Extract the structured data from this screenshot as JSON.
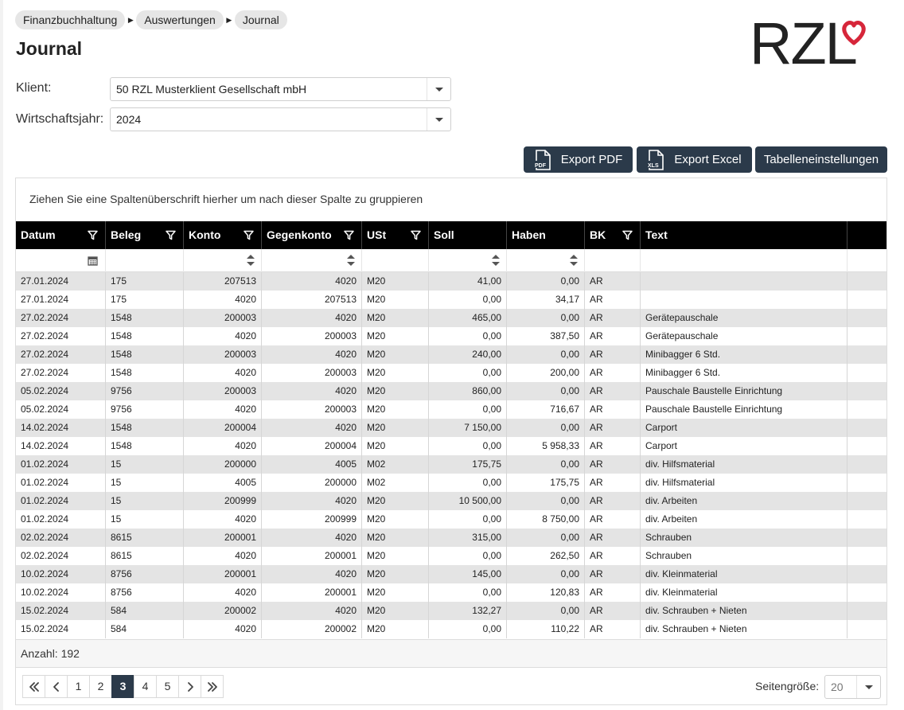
{
  "breadcrumb": [
    "Finanzbuchhaltung",
    "Auswertungen",
    "Journal"
  ],
  "page_title": "Journal",
  "form": {
    "klient_label": "Klient:",
    "klient_value": "50 RZL Musterklient Gesellschaft mbH",
    "wj_label": "Wirtschaftsjahr:",
    "wj_value": "2024"
  },
  "logo_text": "RZL",
  "toolbar": {
    "export_pdf": "Export PDF",
    "pdf_icon_text": "PDF",
    "export_excel": "Export Excel",
    "xls_icon_text": "XLS",
    "table_settings": "Tabelleneinstellungen"
  },
  "grid": {
    "group_hint": "Ziehen Sie eine Spaltenüberschrift hierher um nach dieser Spalte zu gruppieren",
    "columns": [
      "Datum",
      "Beleg",
      "Konto",
      "Gegenkonto",
      "USt",
      "Soll",
      "Haben",
      "BK",
      "Text"
    ],
    "rows": [
      [
        "27.01.2024",
        "175",
        "207513",
        "4020",
        "M20",
        "41,00",
        "0,00",
        "AR",
        ""
      ],
      [
        "27.01.2024",
        "175",
        "4020",
        "207513",
        "M20",
        "0,00",
        "34,17",
        "AR",
        ""
      ],
      [
        "27.02.2024",
        "1548",
        "200003",
        "4020",
        "M20",
        "465,00",
        "0,00",
        "AR",
        "Gerätepauschale"
      ],
      [
        "27.02.2024",
        "1548",
        "4020",
        "200003",
        "M20",
        "0,00",
        "387,50",
        "AR",
        "Gerätepauschale"
      ],
      [
        "27.02.2024",
        "1548",
        "200003",
        "4020",
        "M20",
        "240,00",
        "0,00",
        "AR",
        "Minibagger 6 Std."
      ],
      [
        "27.02.2024",
        "1548",
        "4020",
        "200003",
        "M20",
        "0,00",
        "200,00",
        "AR",
        "Minibagger 6 Std."
      ],
      [
        "05.02.2024",
        "9756",
        "200003",
        "4020",
        "M20",
        "860,00",
        "0,00",
        "AR",
        "Pauschale Baustelle Einrichtung"
      ],
      [
        "05.02.2024",
        "9756",
        "4020",
        "200003",
        "M20",
        "0,00",
        "716,67",
        "AR",
        "Pauschale Baustelle Einrichtung"
      ],
      [
        "14.02.2024",
        "1548",
        "200004",
        "4020",
        "M20",
        "7 150,00",
        "0,00",
        "AR",
        "Carport"
      ],
      [
        "14.02.2024",
        "1548",
        "4020",
        "200004",
        "M20",
        "0,00",
        "5 958,33",
        "AR",
        "Carport"
      ],
      [
        "01.02.2024",
        "15",
        "200000",
        "4005",
        "M02",
        "175,75",
        "0,00",
        "AR",
        "div. Hilfsmaterial"
      ],
      [
        "01.02.2024",
        "15",
        "4005",
        "200000",
        "M02",
        "0,00",
        "175,75",
        "AR",
        "div. Hilfsmaterial"
      ],
      [
        "01.02.2024",
        "15",
        "200999",
        "4020",
        "M20",
        "10 500,00",
        "0,00",
        "AR",
        "div. Arbeiten"
      ],
      [
        "01.02.2024",
        "15",
        "4020",
        "200999",
        "M20",
        "0,00",
        "8 750,00",
        "AR",
        "div. Arbeiten"
      ],
      [
        "02.02.2024",
        "8615",
        "200001",
        "4020",
        "M20",
        "315,00",
        "0,00",
        "AR",
        "Schrauben"
      ],
      [
        "02.02.2024",
        "8615",
        "4020",
        "200001",
        "M20",
        "0,00",
        "262,50",
        "AR",
        "Schrauben"
      ],
      [
        "10.02.2024",
        "8756",
        "200001",
        "4020",
        "M20",
        "145,00",
        "0,00",
        "AR",
        "div. Kleinmaterial"
      ],
      [
        "10.02.2024",
        "8756",
        "4020",
        "200001",
        "M20",
        "0,00",
        "120,83",
        "AR",
        "div. Kleinmaterial"
      ],
      [
        "15.02.2024",
        "584",
        "200002",
        "4020",
        "M20",
        "132,27",
        "0,00",
        "AR",
        "div. Schrauben + Nieten"
      ],
      [
        "15.02.2024",
        "584",
        "4020",
        "200002",
        "M20",
        "0,00",
        "110,22",
        "AR",
        "div. Schrauben + Nieten"
      ]
    ],
    "count_label": "Anzahl: 192"
  },
  "pager": {
    "pages": [
      "1",
      "2",
      "3",
      "4",
      "5"
    ],
    "current_page": "3",
    "page_size_label": "Seitengröße:",
    "page_size": "20"
  },
  "colors": {
    "accent": "#2b3a4a",
    "header_bg": "#000000",
    "row_alt": "#e4e4e4",
    "logo_heart": "#d6263a"
  },
  "icons": {
    "filter": "filter-icon",
    "calendar": "calendar-icon",
    "sort": "sort-arrows-icon",
    "dropdown": "chevron-down-icon",
    "file": "file-icon"
  }
}
